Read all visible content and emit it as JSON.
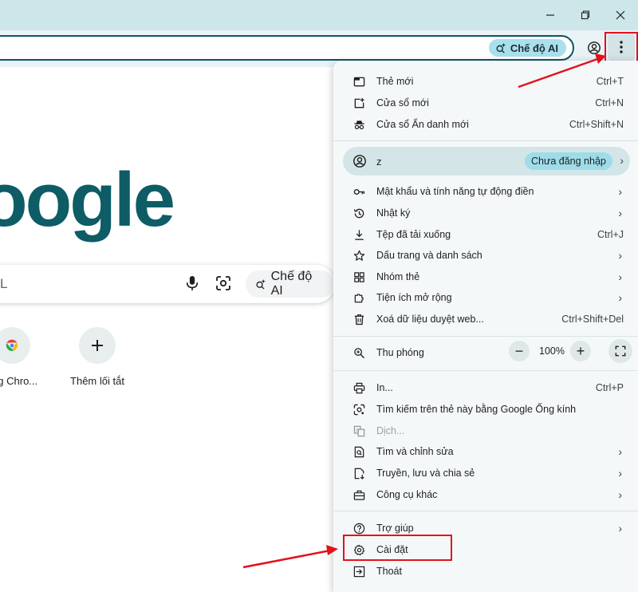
{
  "window": {
    "controls": [
      "minimize-icon",
      "restore-icon",
      "close-icon"
    ]
  },
  "toolbar": {
    "ai_mode_label": "Chế độ AI"
  },
  "page": {
    "logo_text": "oogle",
    "search_placeholder": "L",
    "ai_mode_button": "Chế độ AI",
    "shortcuts": [
      {
        "label": "ằng Chro..."
      },
      {
        "label": "Thêm lối tắt"
      }
    ]
  },
  "menu": {
    "new_tab": {
      "label": "Thẻ mới",
      "shortcut": "Ctrl+T"
    },
    "new_window": {
      "label": "Cửa sổ mới",
      "shortcut": "Ctrl+N"
    },
    "incognito": {
      "label": "Cửa sổ Ẩn danh mới",
      "shortcut": "Ctrl+Shift+N"
    },
    "profile": {
      "name": "z",
      "status": "Chưa đăng nhập"
    },
    "passwords": {
      "label": "Mật khẩu và tính năng tự động điền"
    },
    "history": {
      "label": "Nhật ký"
    },
    "downloads": {
      "label": "Tệp đã tải xuống",
      "shortcut": "Ctrl+J"
    },
    "bookmarks": {
      "label": "Dấu trang và danh sách"
    },
    "tab_groups": {
      "label": "Nhóm thẻ"
    },
    "extensions": {
      "label": "Tiện ích mở rộng"
    },
    "clear_data": {
      "label": "Xoá dữ liệu duyệt web...",
      "shortcut": "Ctrl+Shift+Del"
    },
    "zoom": {
      "label": "Thu phóng",
      "value": "100%",
      "minus": "−",
      "plus": "+"
    },
    "print": {
      "label": "In...",
      "shortcut": "Ctrl+P"
    },
    "lens": {
      "label": "Tìm kiếm trên thẻ này bằng Google Ống kính"
    },
    "translate": {
      "label": "Dịch..."
    },
    "find_edit": {
      "label": "Tìm và chỉnh sửa"
    },
    "cast": {
      "label": "Truyền, lưu và chia sẻ"
    },
    "more_tools": {
      "label": "Công cụ khác"
    },
    "help": {
      "label": "Trợ giúp"
    },
    "settings": {
      "label": "Cài đặt"
    },
    "exit": {
      "label": "Thoát"
    },
    "chevron": "›"
  },
  "colors": {
    "titlebar": "#cde6ea",
    "accent_teal": "#0d5c66",
    "highlight_red": "#e3111c"
  }
}
